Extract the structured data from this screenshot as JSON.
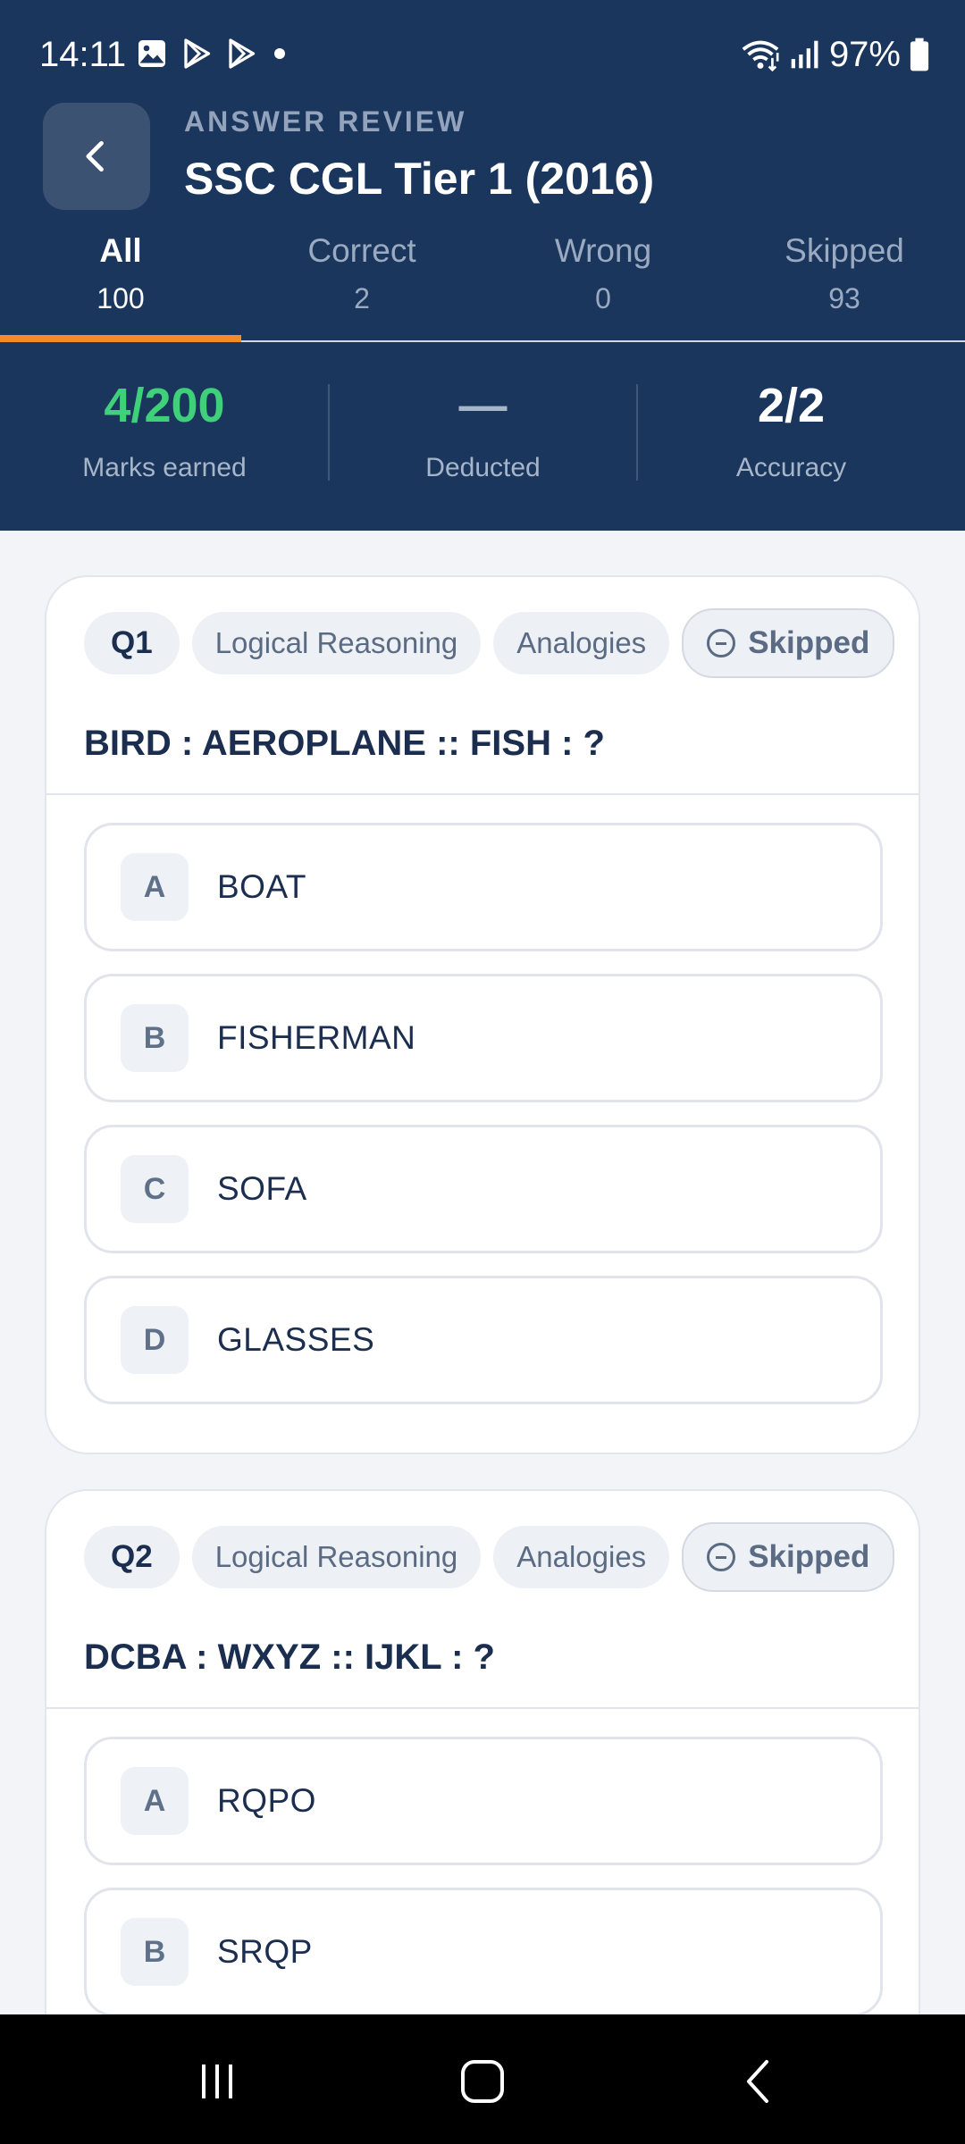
{
  "status_bar": {
    "time": "14:11",
    "battery": "97%",
    "notification_icons": [
      "gallery-icon",
      "play-store-icon",
      "play-store-icon",
      "dot-icon"
    ],
    "system_icons": [
      "wifi-icon",
      "signal-icon",
      "battery-icon"
    ]
  },
  "header": {
    "kicker": "ANSWER REVIEW",
    "title": "SSC CGL Tier 1 (2016)"
  },
  "tabs": [
    {
      "label": "All",
      "count": "100",
      "active": true
    },
    {
      "label": "Correct",
      "count": "2",
      "active": false
    },
    {
      "label": "Wrong",
      "count": "0",
      "active": false
    },
    {
      "label": "Skipped",
      "count": "93",
      "active": false
    }
  ],
  "stats": [
    {
      "value": "4/200",
      "label": "Marks earned"
    },
    {
      "value": "—",
      "label": "Deducted"
    },
    {
      "value": "2/2",
      "label": "Accuracy"
    }
  ],
  "questions": [
    {
      "number": "Q1",
      "subject": "Logical Reasoning",
      "topic": "Analogies",
      "status": "Skipped",
      "text": "BIRD : AEROPLANE :: FISH : ?",
      "options": [
        {
          "letter": "A",
          "text": "BOAT"
        },
        {
          "letter": "B",
          "text": "FISHERMAN"
        },
        {
          "letter": "C",
          "text": "SOFA"
        },
        {
          "letter": "D",
          "text": "GLASSES"
        }
      ]
    },
    {
      "number": "Q2",
      "subject": "Logical Reasoning",
      "topic": "Analogies",
      "status": "Skipped",
      "text": "DCBA : WXYZ :: IJKL : ?",
      "options": [
        {
          "letter": "A",
          "text": "RQPO"
        },
        {
          "letter": "B",
          "text": "SRQP"
        }
      ]
    }
  ],
  "colors": {
    "header_bg": "#1b365d",
    "accent": "#f28c28",
    "marks_green": "#3fd07a",
    "page_bg": "#f2f4f7"
  }
}
